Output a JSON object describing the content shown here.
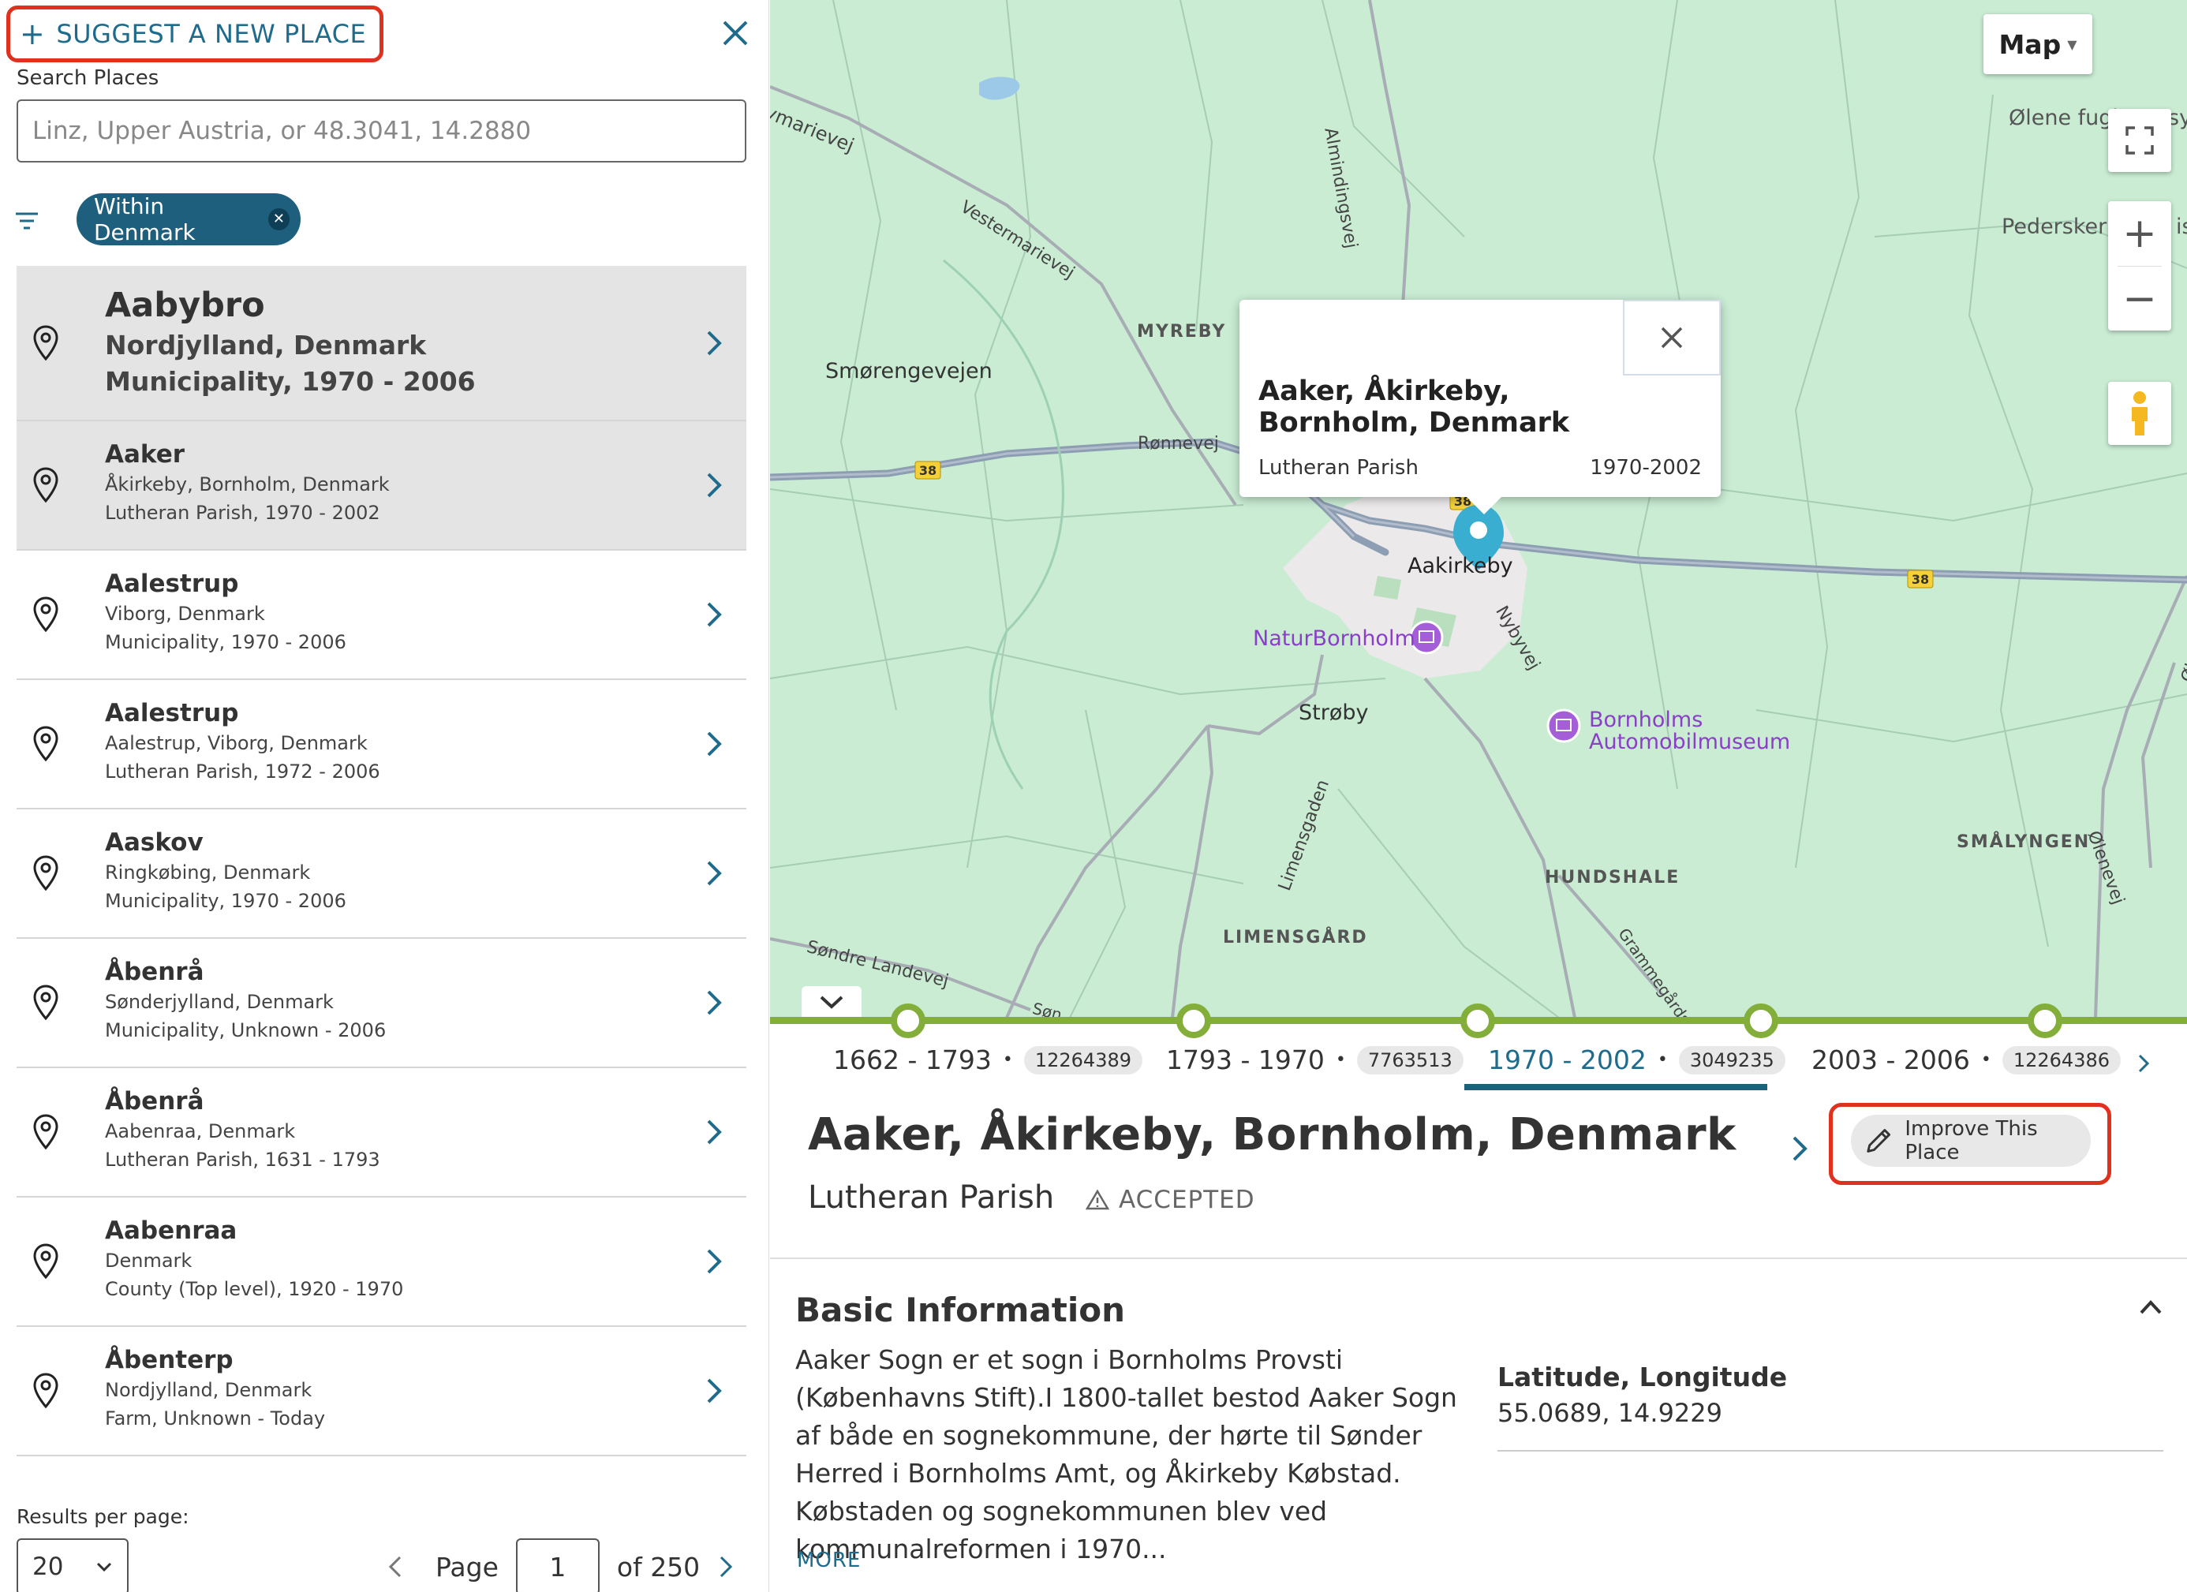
{
  "left_panel": {
    "suggest_label": "SUGGEST A NEW PLACE",
    "search_label": "Search Places",
    "search_placeholder": "Linz, Upper Austria, or 48.3041, 14.2880",
    "search_value": "",
    "filter_chip": "Within Denmark",
    "results": [
      {
        "name": "Aabybro",
        "region": "Nordjylland, Denmark",
        "type": "Municipality, 1970 - 2006"
      },
      {
        "name": "Aaker",
        "region": "Åkirkeby, Bornholm, Denmark",
        "type": "Lutheran Parish, 1970 - 2002"
      },
      {
        "name": "Aalestrup",
        "region": "Viborg, Denmark",
        "type": "Municipality, 1970 - 2006"
      },
      {
        "name": "Aalestrup",
        "region": "Aalestrup, Viborg, Denmark",
        "type": "Lutheran Parish, 1972 - 2006"
      },
      {
        "name": "Aaskov",
        "region": "Ringkøbing, Denmark",
        "type": "Municipality, 1970 - 2006"
      },
      {
        "name": "Åbenrå",
        "region": "Sønderjylland, Denmark",
        "type": "Municipality, Unknown - 2006"
      },
      {
        "name": "Åbenrå",
        "region": "Aabenraa, Denmark",
        "type": "Lutheran Parish, 1631 - 1793"
      },
      {
        "name": "Aabenraa",
        "region": "Denmark",
        "type": "County (Top level), 1920 - 1970"
      },
      {
        "name": "Åbenterp",
        "region": "Nordjylland, Denmark",
        "type": "Farm, Unknown - Today"
      }
    ],
    "results_per_page_label": "Results per page:",
    "results_per_page_value": "20",
    "page_label": "Page",
    "page_value": "1",
    "page_of": "of 250"
  },
  "map": {
    "type_button": "Map",
    "labels": {
      "ymarievej": "ymarievej",
      "almindingsvej": "Almindingsvej",
      "vestermarievej": "Vestermarievej",
      "olene_fugl": "Ølene fugl",
      "sy": "sy",
      "pedersker": "Pedersker",
      "is": "is",
      "myreby": "MYREBY",
      "smorengevejen": "Smørengevejen",
      "ronnevej": "Rønnevej",
      "aakirkeby": "Aakirkeby",
      "naturbornholm": "NaturBornholm",
      "nybyvej": "Nybyvej",
      "strobya": "Strøby",
      "bornholms1": "Bornholms",
      "bornholms2": "Automobilmuseum",
      "limensgaden": "Limensgaden",
      "hundshale": "HUNDSHALE",
      "smalyngen": "SMÅLYNGEN",
      "olenevej_v": "Ølenevej",
      "olenevej_v2": "Ølenevej",
      "limensgaard": "LIMENSGÅRD",
      "sondre_landevej": "Søndre Landevej",
      "son": "Søn",
      "grammegards": "Grammegårdsv",
      "route_38_a": "38",
      "route_38_b": "38",
      "route_38_c": "38"
    },
    "popup": {
      "title": "Aaker, Åkirkeby, Bornholm, Denmark",
      "type": "Lutheran Parish",
      "dates": "1970-2002"
    },
    "colors": {
      "land": "#c9ecd3",
      "road": "#8d9db2",
      "marker": "#3aaed1",
      "timeline": "#83ae3a"
    }
  },
  "timeline": [
    {
      "range": "1662 - 1793",
      "id": "12264389"
    },
    {
      "range": "1793 - 1970",
      "id": "7763513"
    },
    {
      "range": "1970 - 2002",
      "id": "3049235",
      "active": true
    },
    {
      "range": "2003 - 2006",
      "id": "12264386"
    }
  ],
  "details": {
    "title_parts": [
      "Aaker,",
      "Åkirkeby,",
      "Bornholm,",
      "Denmark"
    ],
    "subtype": "Lutheran Parish",
    "status": "ACCEPTED",
    "improve_label": "Improve This Place",
    "basic_info_title": "Basic Information",
    "basic_info_text": "Aaker Sogn er et sogn i Bornholms Provsti (Københavns Stift).I 1800-tallet bestod Aaker Sogn af både en sognekommune, der hørte til Sønder Herred i Bornholms Amt, og Åkirkeby Købstad. Købstaden og sognekommunen blev ved kommunalreformen i 1970...",
    "more_label": "MORE",
    "latlong_label": "Latitude, Longitude",
    "latlong_value": "55.0689, 14.9229"
  }
}
